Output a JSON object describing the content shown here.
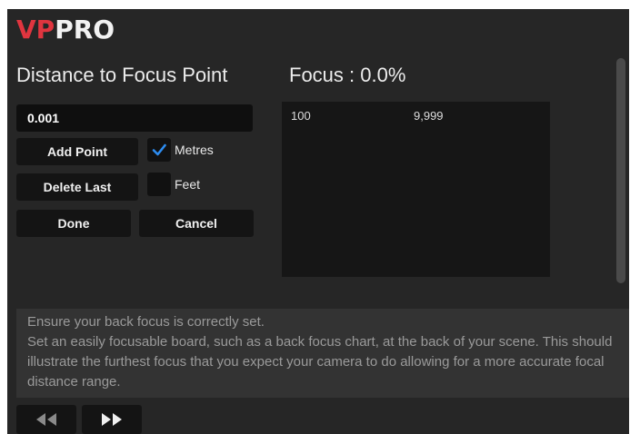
{
  "app": {
    "logo_part1": "VP",
    "logo_part2": "PRO"
  },
  "form": {
    "distance_label": "Distance to Focus Point",
    "distance_value": "0.001",
    "add_point_label": "Add Point",
    "delete_last_label": "Delete Last",
    "done_label": "Done",
    "cancel_label": "Cancel",
    "units": [
      {
        "label": "Metres",
        "checked": true
      },
      {
        "label": "Feet",
        "checked": false
      }
    ]
  },
  "focus": {
    "label": "Focus :  0.0%",
    "rows": [
      {
        "col1": "100",
        "col2": "9,999"
      }
    ]
  },
  "instructions": {
    "line1": "Ensure your back focus is correctly set.",
    "line2": "Set an easily focusable board, such as a back focus chart, at the back of your scene. This should illustrate the furthest focus that you expect your camera to do allowing for a more accurate focal distance range."
  },
  "nav": {
    "prev_icon": "rewind-icon",
    "next_icon": "fast-forward-icon"
  },
  "colors": {
    "brand_red": "#e0353f",
    "check_blue": "#2d8cf0",
    "panel_bg": "#262626"
  }
}
